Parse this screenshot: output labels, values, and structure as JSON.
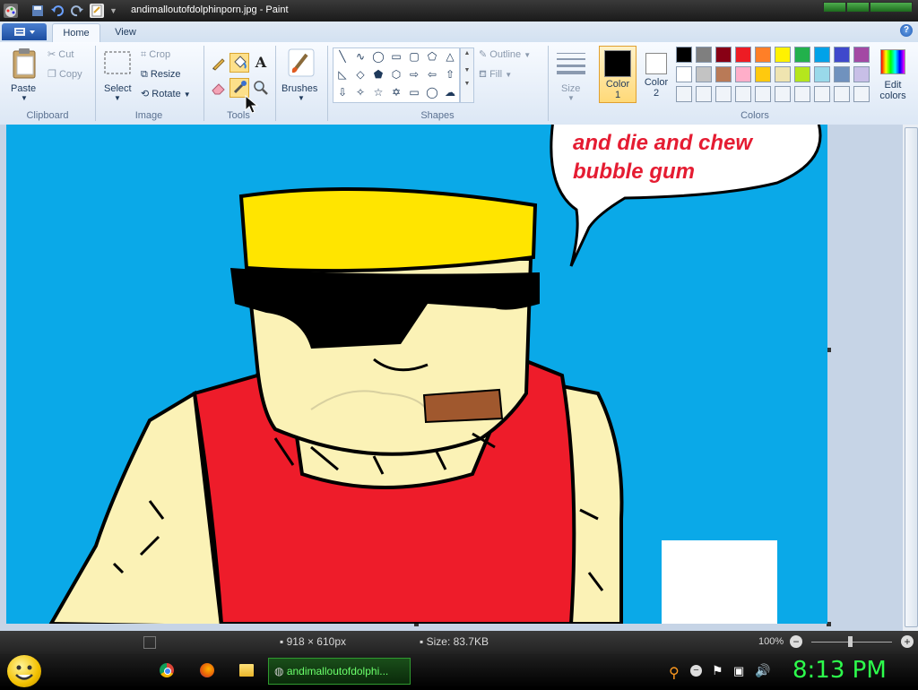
{
  "window": {
    "title": "andimalloutofdolphinporn.jpg - Paint"
  },
  "ribbon_tabs": [
    {
      "label": "Home"
    },
    {
      "label": "View"
    }
  ],
  "clipboard": {
    "paste": "Paste",
    "cut": "Cut",
    "copy": "Copy",
    "group": "Clipboard"
  },
  "image": {
    "select": "Select",
    "crop": "Crop",
    "resize": "Resize",
    "rotate": "Rotate",
    "group": "Image"
  },
  "tools": {
    "group": "Tools",
    "brushes": "Brushes",
    "active_tool": "color-picker-icon"
  },
  "shapes": {
    "group": "Shapes",
    "outline": "Outline",
    "fill": "Fill",
    "size": "Size"
  },
  "colors": {
    "group": "Colors",
    "color1_label": "Color",
    "color1_num": "1",
    "color2_label": "Color",
    "color2_num": "2",
    "color1": "#000000",
    "color2": "#ffffff",
    "edit_line1": "Edit",
    "edit_line2": "colors",
    "palette_row1": [
      "#000000",
      "#7f7f7f",
      "#880015",
      "#ed1c24",
      "#ff7f27",
      "#fff200",
      "#22b14c",
      "#00a2e8",
      "#3f48cc",
      "#a349a4"
    ],
    "palette_row2": [
      "#ffffff",
      "#c3c3c3",
      "#b97a57",
      "#ffaec9",
      "#ffc90e",
      "#efe4b0",
      "#b5e61d",
      "#99d9ea",
      "#7092be",
      "#c8bfe7"
    ],
    "palette_row3": [
      "#f0f4f9",
      "#f0f4f9",
      "#f0f4f9",
      "#f0f4f9",
      "#f0f4f9",
      "#f0f4f9",
      "#f0f4f9",
      "#f0f4f9",
      "#f0f4f9",
      "#f0f4f9"
    ]
  },
  "canvas": {
    "speech_line1": "and die and chew",
    "speech_line2": "bubble gum",
    "background": "#0aa9e8"
  },
  "status": {
    "dimensions": "918 × 610px",
    "size": "Size: 83.7KB",
    "zoom": "100%"
  },
  "taskbar": {
    "active_window": "andimalloutofdolphi...",
    "clock": "8:13 PM"
  }
}
